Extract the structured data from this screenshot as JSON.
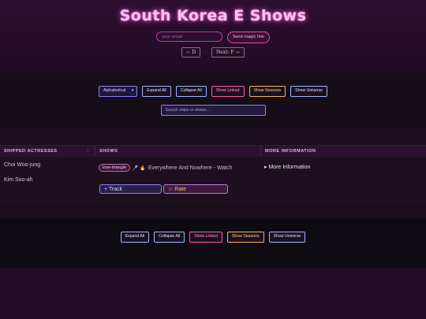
{
  "header": {
    "title": "South Korea E Shows",
    "email_placeholder": "your email",
    "magic_link_label": "Send magic link",
    "prev_label": "← D",
    "separator": "·",
    "next_label": "Next: F →"
  },
  "controls": {
    "sort_select": "Alphabetical",
    "expand_all": "Expand All",
    "collapse_all": "Collapse All",
    "show_linked": "Show Linked",
    "show_seasons": "Show Seasons",
    "show_universe": "Show Universe",
    "search_placeholder": "Search ships or shows..."
  },
  "table": {
    "headers": {
      "actresses": "SHIPPED ACTRESSES",
      "sort_indicator": "↑",
      "shows": "SHOWS",
      "more": "MORE INFORMATION"
    },
    "rows": [
      {
        "actresses": [
          "Choi Woo-jung",
          "Kim Soo-ah"
        ],
        "tag": "love-triangle",
        "show_title": "Everywhere And Nowhere - Watch",
        "track_label": "+ Track",
        "rate_label": "☆ Rate",
        "more_label": "▸ More Information"
      }
    ]
  },
  "footer_controls": {
    "expand_all": "Expand All",
    "collapse_all": "Collapse All",
    "show_linked": "Show Linked",
    "show_seasons": "Show Seasons",
    "show_universe": "Show Universe"
  },
  "colors": {
    "title_glow": "#ff4fd0",
    "blue_button": "#9db6ff",
    "pink_button": "#ff5aa0",
    "orange_button": "#ffb35a"
  }
}
